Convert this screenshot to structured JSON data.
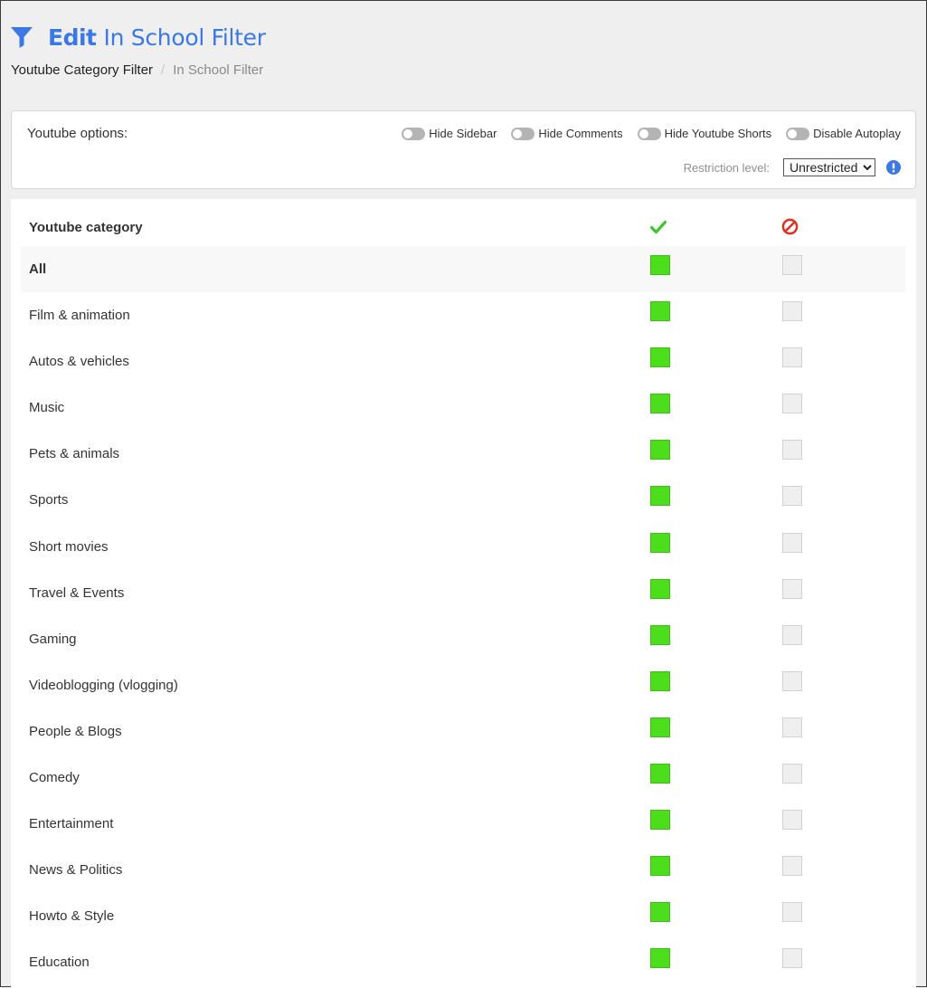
{
  "header": {
    "title_bold": "Edit",
    "title_rest": "In School Filter"
  },
  "breadcrumb": {
    "link": "Youtube Category Filter",
    "separator": "/",
    "current": "In School Filter"
  },
  "options": {
    "label": "Youtube options:",
    "toggles": [
      {
        "label": "Hide Sidebar",
        "on": false
      },
      {
        "label": "Hide Comments",
        "on": false
      },
      {
        "label": "Hide Youtube Shorts",
        "on": false
      },
      {
        "label": "Disable Autoplay",
        "on": false
      }
    ],
    "restriction_label": "Restriction level:",
    "restriction_value": "Unrestricted"
  },
  "table": {
    "header_label": "Youtube category",
    "rows": [
      {
        "label": "All",
        "allowed": true
      },
      {
        "label": "Film & animation",
        "allowed": true
      },
      {
        "label": "Autos & vehicles",
        "allowed": true
      },
      {
        "label": "Music",
        "allowed": true
      },
      {
        "label": "Pets & animals",
        "allowed": true
      },
      {
        "label": "Sports",
        "allowed": true
      },
      {
        "label": "Short movies",
        "allowed": true
      },
      {
        "label": "Travel & Events",
        "allowed": true
      },
      {
        "label": "Gaming",
        "allowed": true
      },
      {
        "label": "Videoblogging (vlogging)",
        "allowed": true
      },
      {
        "label": "People & Blogs",
        "allowed": true
      },
      {
        "label": "Comedy",
        "allowed": true
      },
      {
        "label": "Entertainment",
        "allowed": true
      },
      {
        "label": "News & Politics",
        "allowed": true
      },
      {
        "label": "Howto & Style",
        "allowed": true
      },
      {
        "label": "Education",
        "allowed": true
      }
    ]
  },
  "colors": {
    "accent": "#3b78e7",
    "allow_green": "#4cde1c",
    "block_red": "#e0301e",
    "check_green": "#3dc62a"
  },
  "icons": {
    "title": "filter-icon",
    "allow_header": "check-icon",
    "block_header": "block-icon",
    "info": "info-icon"
  }
}
